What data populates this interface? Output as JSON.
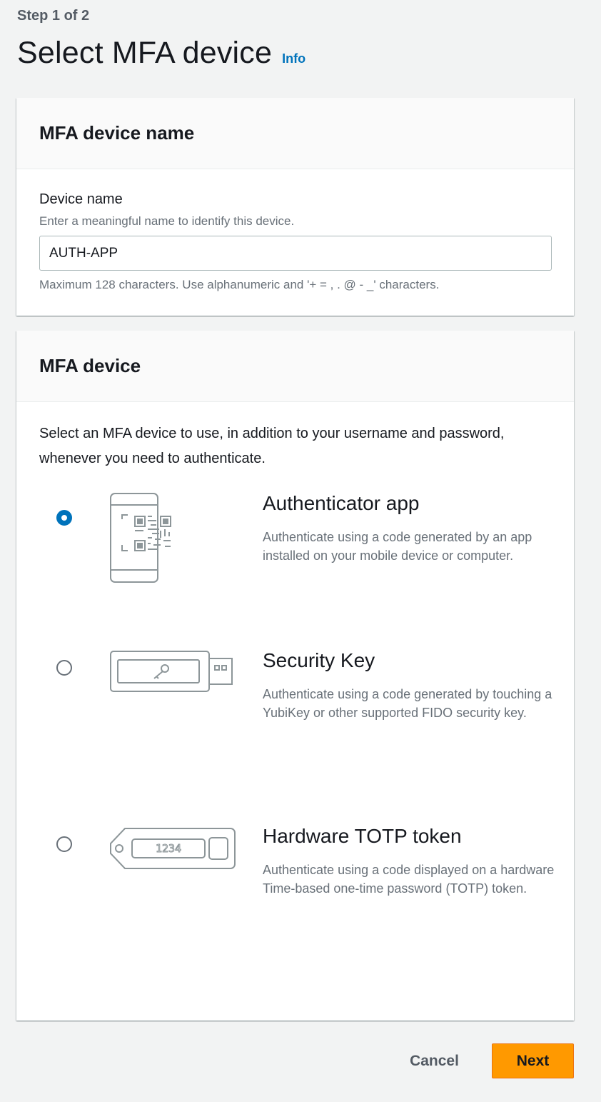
{
  "header": {
    "step": "Step 1 of 2",
    "title": "Select MFA device",
    "info_link": "Info"
  },
  "name_section": {
    "heading": "MFA device name",
    "label": "Device name",
    "description": "Enter a meaningful name to identify this device.",
    "value": "AUTH-APP",
    "constraint": "Maximum 128 characters. Use alphanumeric and '+ = , . @ - _' characters."
  },
  "device_section": {
    "heading": "MFA device",
    "intro": "Select an MFA device to use, in addition to your username and password, whenever you need to authenticate.",
    "selected": "authenticator",
    "options": [
      {
        "id": "authenticator",
        "icon": "phone-qr-icon",
        "title": "Authenticator app",
        "description": "Authenticate using a code generated by an app installed on your mobile device or computer."
      },
      {
        "id": "security_key",
        "icon": "usb-key-icon",
        "title": "Security Key",
        "description": "Authenticate using a code generated by touching a YubiKey or other supported FIDO security key."
      },
      {
        "id": "totp",
        "icon": "totp-token-icon",
        "title": "Hardware TOTP token",
        "description": "Authenticate using a code displayed on a hardware Time-based one-time password (TOTP) token.",
        "token_display": "1234"
      }
    ]
  },
  "footer": {
    "cancel_label": "Cancel",
    "next_label": "Next"
  },
  "colors": {
    "accent": "#0073bb",
    "primary_button": "#ff9900",
    "background": "#f2f3f3"
  }
}
